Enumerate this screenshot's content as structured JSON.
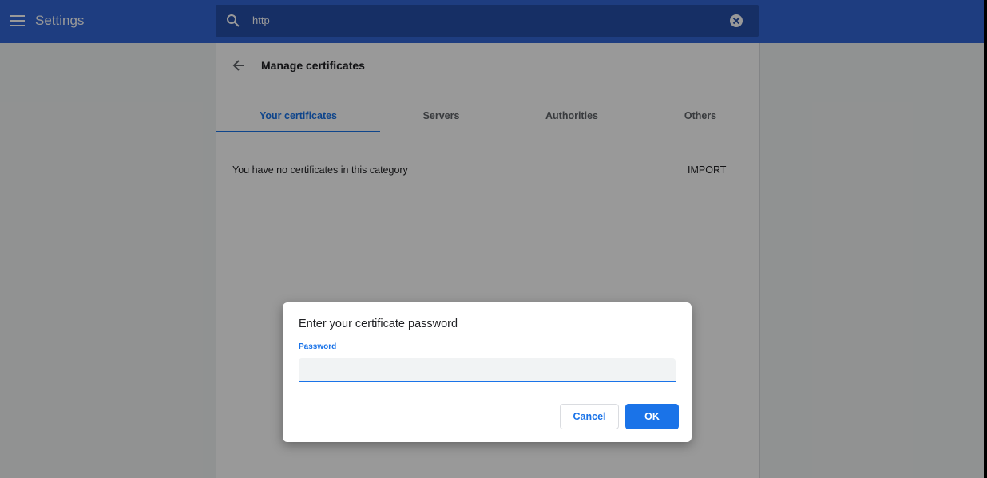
{
  "header": {
    "app_title": "Settings",
    "menu_icon": "hamburger-menu-icon",
    "search": {
      "value": "http",
      "icon": "search-icon",
      "clear_icon": "clear-icon"
    }
  },
  "page": {
    "title": "Manage certificates",
    "back_icon": "arrow-back-icon",
    "tabs": [
      {
        "label": "Your certificates",
        "active": true
      },
      {
        "label": "Servers",
        "active": false
      },
      {
        "label": "Authorities",
        "active": false
      },
      {
        "label": "Others",
        "active": false
      }
    ],
    "empty_message": "You have no certificates in this category",
    "import_label": "IMPORT"
  },
  "dialog": {
    "title": "Enter your certificate password",
    "field_label": "Password",
    "password_value": "",
    "cancel_label": "Cancel",
    "ok_label": "OK"
  },
  "colors": {
    "header_bg": "#3367d6",
    "search_bg": "#264fa8",
    "accent": "#1a73e8",
    "overlay": "rgba(0,0,0,0.4)"
  }
}
